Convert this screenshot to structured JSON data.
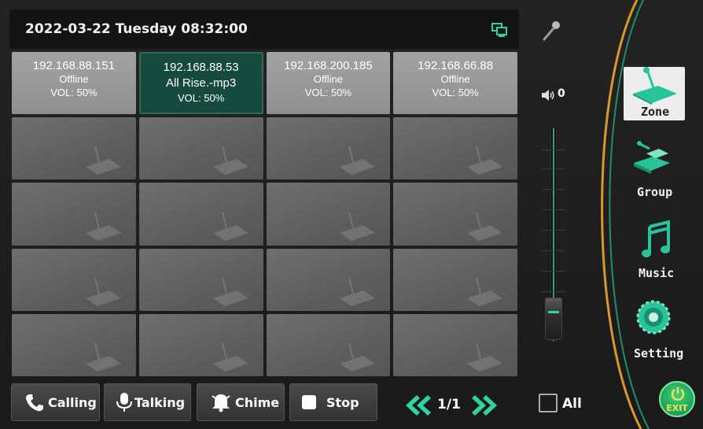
{
  "header": {
    "datetime": "2022-03-22 Tuesday 08:32:00"
  },
  "zones": [
    {
      "ip": "192.168.88.151",
      "status": "Offline",
      "volume": "VOL: 50%",
      "active": false
    },
    {
      "ip": "192.168.88.53",
      "status": "All Rise.-mp3",
      "volume": "VOL: 50%",
      "active": true
    },
    {
      "ip": "192.168.200.185",
      "status": "Offline",
      "volume": "VOL: 50%",
      "active": false
    },
    {
      "ip": "192.168.66.88",
      "status": "Offline",
      "volume": "VOL: 50%",
      "active": false
    }
  ],
  "volume": {
    "value": "0",
    "level": 0
  },
  "nav": {
    "zone": "Zone",
    "group": "Group",
    "music": "Music",
    "setting": "Setting"
  },
  "bottom": {
    "calling": "Calling",
    "talking": "Talking",
    "chime": "Chime",
    "stop": "Stop",
    "page": "1/1",
    "all": "All",
    "exit": "EXIT"
  },
  "colors": {
    "accent": "#2fd3a0",
    "active_cell": "#174a3f",
    "arc": "#d69a2a",
    "exit_text": "#f1e35a"
  }
}
